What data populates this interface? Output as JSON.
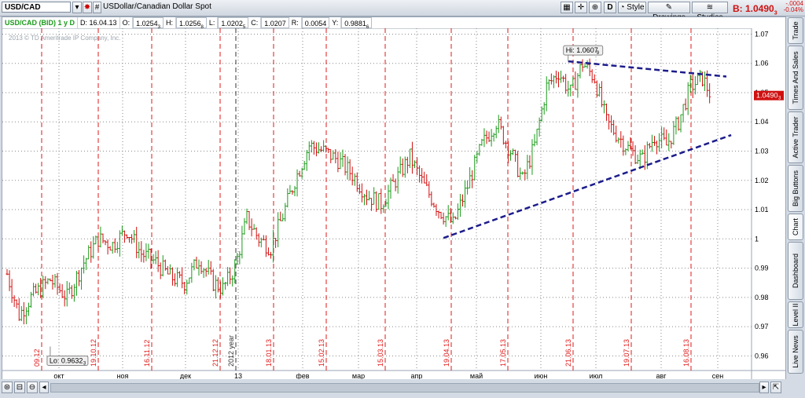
{
  "toolbar": {
    "symbol": "USD/CAD",
    "hash": "#",
    "description": "USDollar/Canadian Dollar Spot",
    "d_label": "D",
    "style_label": "Style",
    "drawings_label": "Drawings",
    "studies_label": "Studies",
    "bid_label": "B: 1.0490",
    "bid_frac": "3",
    "change_abs": "-.0004",
    "change_pct": "-0.04%"
  },
  "infobar": {
    "study": "USD/CAD (BID) 1 y D",
    "date_label": "D: 16.04.13",
    "open_label": "O:",
    "open_value": "1.0254",
    "open_frac": "3",
    "high_label": "H:",
    "high_value": "1.0256",
    "high_frac": "8",
    "low_label": "L:",
    "low_value": "1.0202",
    "low_frac": "5",
    "close_label": "C:",
    "close_value": "1.0207",
    "range_label": "R:",
    "range_value": "0.0054",
    "y_label": "Y:",
    "y_value": "0.9881",
    "y_frac": "6"
  },
  "copyright": "2013 © TD Ameritrade IP Company, Inc.",
  "side_tabs": [
    "Trade",
    "Times And Sales",
    "Active Trader",
    "Big Buttons",
    "Chart",
    "Dashboard",
    "Level II",
    "Live News"
  ],
  "colors": {
    "up": "#1a9a1a",
    "down": "#d01010",
    "trend": "#1c1c8c",
    "grid": "#8a8a8a"
  },
  "chart_data": {
    "type": "candlestick",
    "ylim": [
      0.955,
      1.072
    ],
    "y_ticks": [
      "0.96",
      "0.97",
      "0.98",
      "0.99",
      "1",
      "1.01",
      "1.02",
      "1.03",
      "1.04",
      "1.05",
      "1.06",
      "1.07"
    ],
    "x_month_labels": [
      "окт",
      "ноя",
      "дек",
      "13",
      "фев",
      "мар",
      "апр",
      "май",
      "июн",
      "июл",
      "авг",
      "сен"
    ],
    "vertical_markers": [
      "09.12",
      "19.10.12",
      "16.11.12",
      "21.12.12",
      "2012 year",
      "18.01.13",
      "15.02.13",
      "15.03.13",
      "19.04.13",
      "17.05.13",
      "21.06.13",
      "19.07.13",
      "16.08.13"
    ],
    "high_annotation": "Hi: 1.0607",
    "high_annotation_frac": "9",
    "low_annotation": "Lo: 0.9632",
    "low_annotation_frac": "3",
    "last_price": "1.0490",
    "last_price_frac": "3",
    "close_path": [
      [
        0,
        0.988
      ],
      [
        5,
        0.974
      ],
      [
        10,
        0.98
      ],
      [
        18,
        0.986
      ],
      [
        25,
        0.98
      ],
      [
        32,
        0.992
      ],
      [
        38,
        1.0
      ],
      [
        44,
        0.998
      ],
      [
        50,
        1.003
      ],
      [
        56,
        0.995
      ],
      [
        62,
        0.992
      ],
      [
        68,
        0.987
      ],
      [
        74,
        0.985
      ],
      [
        80,
        0.993
      ],
      [
        86,
        0.985
      ],
      [
        90,
        0.983
      ],
      [
        95,
        0.99
      ],
      [
        100,
        1.007
      ],
      [
        105,
        1.0
      ],
      [
        110,
        0.997
      ],
      [
        115,
        1.008
      ],
      [
        120,
        1.02
      ],
      [
        126,
        1.032
      ],
      [
        132,
        1.03
      ],
      [
        138,
        1.027
      ],
      [
        144,
        1.022
      ],
      [
        150,
        1.015
      ],
      [
        156,
        1.012
      ],
      [
        162,
        1.02
      ],
      [
        168,
        1.028
      ],
      [
        174,
        1.018
      ],
      [
        180,
        1.01
      ],
      [
        186,
        1.005
      ],
      [
        192,
        1.018
      ],
      [
        198,
        1.032
      ],
      [
        204,
        1.04
      ],
      [
        210,
        1.03
      ],
      [
        215,
        1.02
      ],
      [
        220,
        1.032
      ],
      [
        225,
        1.052
      ],
      [
        230,
        1.057
      ],
      [
        235,
        1.05
      ],
      [
        240,
        1.06
      ],
      [
        245,
        1.055
      ],
      [
        250,
        1.04
      ],
      [
        255,
        1.035
      ],
      [
        260,
        1.03
      ],
      [
        265,
        1.027
      ],
      [
        270,
        1.035
      ],
      [
        275,
        1.032
      ],
      [
        280,
        1.04
      ],
      [
        285,
        1.052
      ],
      [
        290,
        1.055
      ],
      [
        293,
        1.05
      ]
    ],
    "trendlines": [
      {
        "from": [
          234,
          1.0607
        ],
        "to": [
          300,
          1.0555
        ]
      },
      {
        "from": [
          182,
          1.0003
        ],
        "to": [
          302,
          1.0355
        ]
      }
    ]
  }
}
